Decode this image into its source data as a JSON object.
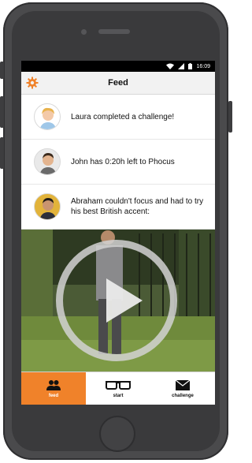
{
  "status_bar": {
    "time": "16:09"
  },
  "header": {
    "title": "Feed",
    "settings_icon": "gear-icon"
  },
  "feed": {
    "items": [
      {
        "text": "Laura completed a challenge!",
        "avatar": "avatar-laura"
      },
      {
        "text": "John has 0:20h left to Phocus",
        "avatar": "avatar-john"
      },
      {
        "text": "Abraham couldn't focus and had to try his best British accent:",
        "avatar": "avatar-abraham"
      }
    ]
  },
  "video": {
    "play_icon": "play-icon"
  },
  "tabbar": {
    "tabs": [
      {
        "label": "feed",
        "icon": "people-icon",
        "active": true
      },
      {
        "label": "start",
        "icon": "glasses-icon",
        "active": false
      },
      {
        "label": "challenge",
        "icon": "envelope-icon",
        "active": false
      }
    ]
  },
  "colors": {
    "accent": "#f0822a",
    "header_bg": "#f2f2f2",
    "statusbar_bg": "#000000"
  }
}
